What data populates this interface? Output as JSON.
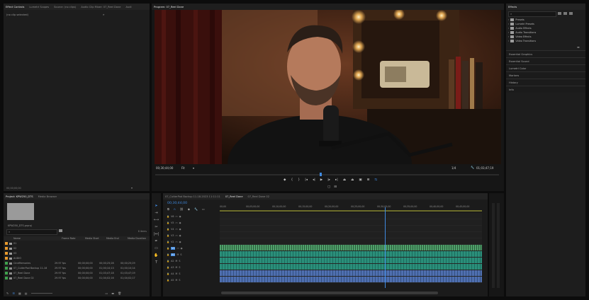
{
  "effect_controls": {
    "tabs": [
      "Effect Controls",
      "Lumetri Scopes",
      "Source: (no clips)",
      "Audio Clip Mixer: 07_Reel Done",
      "Audi"
    ],
    "no_clip_text": "(no clip selected)",
    "timecode": "00;00;00;00"
  },
  "program": {
    "tab_label": "Program: 07_Reel Done",
    "timecode": "00;30;44;00",
    "zoom": "Fit",
    "resolution": "1/4",
    "duration": "01;03;47;19"
  },
  "project": {
    "tabs": [
      "Project: KPW250_DTS",
      "Media Browser"
    ],
    "file_name": "KPW250_DTS.prproj",
    "items_count": "8 items",
    "columns": [
      "Name",
      "Frame Rate",
      "Media Start",
      "Media End",
      "Media Duration"
    ],
    "rows": [
      {
        "name": "01",
        "color": "#e89a2c",
        "type": "bin",
        "frame_rate": "",
        "start": "",
        "end": "",
        "duration": ""
      },
      {
        "name": "02",
        "color": "#e89a2c",
        "type": "bin",
        "frame_rate": "",
        "start": "",
        "end": "",
        "duration": ""
      },
      {
        "name": "03",
        "color": "#e89a2c",
        "type": "bin",
        "frame_rate": "",
        "start": "",
        "end": "",
        "duration": ""
      },
      {
        "name": "AUDIO",
        "color": "#e89a2c",
        "type": "bin",
        "frame_rate": "",
        "start": "",
        "end": "",
        "duration": ""
      },
      {
        "name": "CineMemories",
        "color": "#3fa14d",
        "type": "seq",
        "frame_rate": "29.97 fps",
        "start": "00;00;00;00",
        "end": "00;00;25;28",
        "duration": "00;00;25;29"
      },
      {
        "name": "07_CutterPod Backup 11-18",
        "color": "#3fa14d",
        "type": "seq",
        "frame_rate": "29.97 fps",
        "start": "00;00;00;00",
        "end": "01;00;10;13",
        "duration": "01;00;10;14"
      },
      {
        "name": "07_Reel Done",
        "color": "#3fa14d",
        "type": "seq",
        "frame_rate": "29.97 fps",
        "start": "00;00;00;00",
        "end": "01;03;47;18",
        "duration": "01;03;47;19"
      },
      {
        "name": "07_Reel Done 02",
        "color": "#3fa14d",
        "type": "seq",
        "frame_rate": "29.97 fps",
        "start": "00;00;00;00",
        "end": "01;04;02;16",
        "duration": "01;04;02;17"
      }
    ]
  },
  "timeline": {
    "tabs": [
      "07_CutterPod Backup 11-18-2023 11:11:11",
      "07_Reel Done",
      "07_Reel Done 02"
    ],
    "timecode": "00;30;44;00",
    "ruler_labels": [
      "00;00",
      "00;05;00;00",
      "00;10;00;00",
      "00;15;00;00",
      "00;20;00;00",
      "00;25;00;00",
      "00;30;00;00",
      "00;35;00;00",
      "00;40;00;00",
      "00;45;00;00"
    ],
    "video_tracks": [
      "V6",
      "V5",
      "V4",
      "V3",
      "V2",
      "V1"
    ],
    "audio_tracks": [
      "A1",
      "A2",
      "A3",
      "A4",
      "A5"
    ],
    "playhead_fraction": 0.63,
    "colors": {
      "video_clip": "#4fa06a",
      "audio_clip": "#2a8f7a",
      "audio_clip2": "#4f6fb0",
      "accent": "#3f8ae0",
      "label_green": "#3fa14d",
      "label_orange": "#e89a2c"
    }
  },
  "effects": {
    "tab_label": "Effects",
    "folders": [
      "Presets",
      "Lumetri Presets",
      "Audio Effects",
      "Audio Transitions",
      "Video Effects",
      "Video Transitions"
    ],
    "sections": [
      "Essential Graphics",
      "Essential Sound",
      "Lumetri Color",
      "Markers",
      "History",
      "Info"
    ]
  },
  "icons": [
    "play-icon",
    "step-back-icon",
    "step-forward-icon",
    "mark-in-icon",
    "mark-out-icon",
    "export-frame-icon",
    "wrench-icon",
    "search-icon",
    "selection-tool-icon",
    "razor-tool-icon",
    "pen-tool-icon",
    "hand-tool-icon",
    "type-tool-icon"
  ]
}
